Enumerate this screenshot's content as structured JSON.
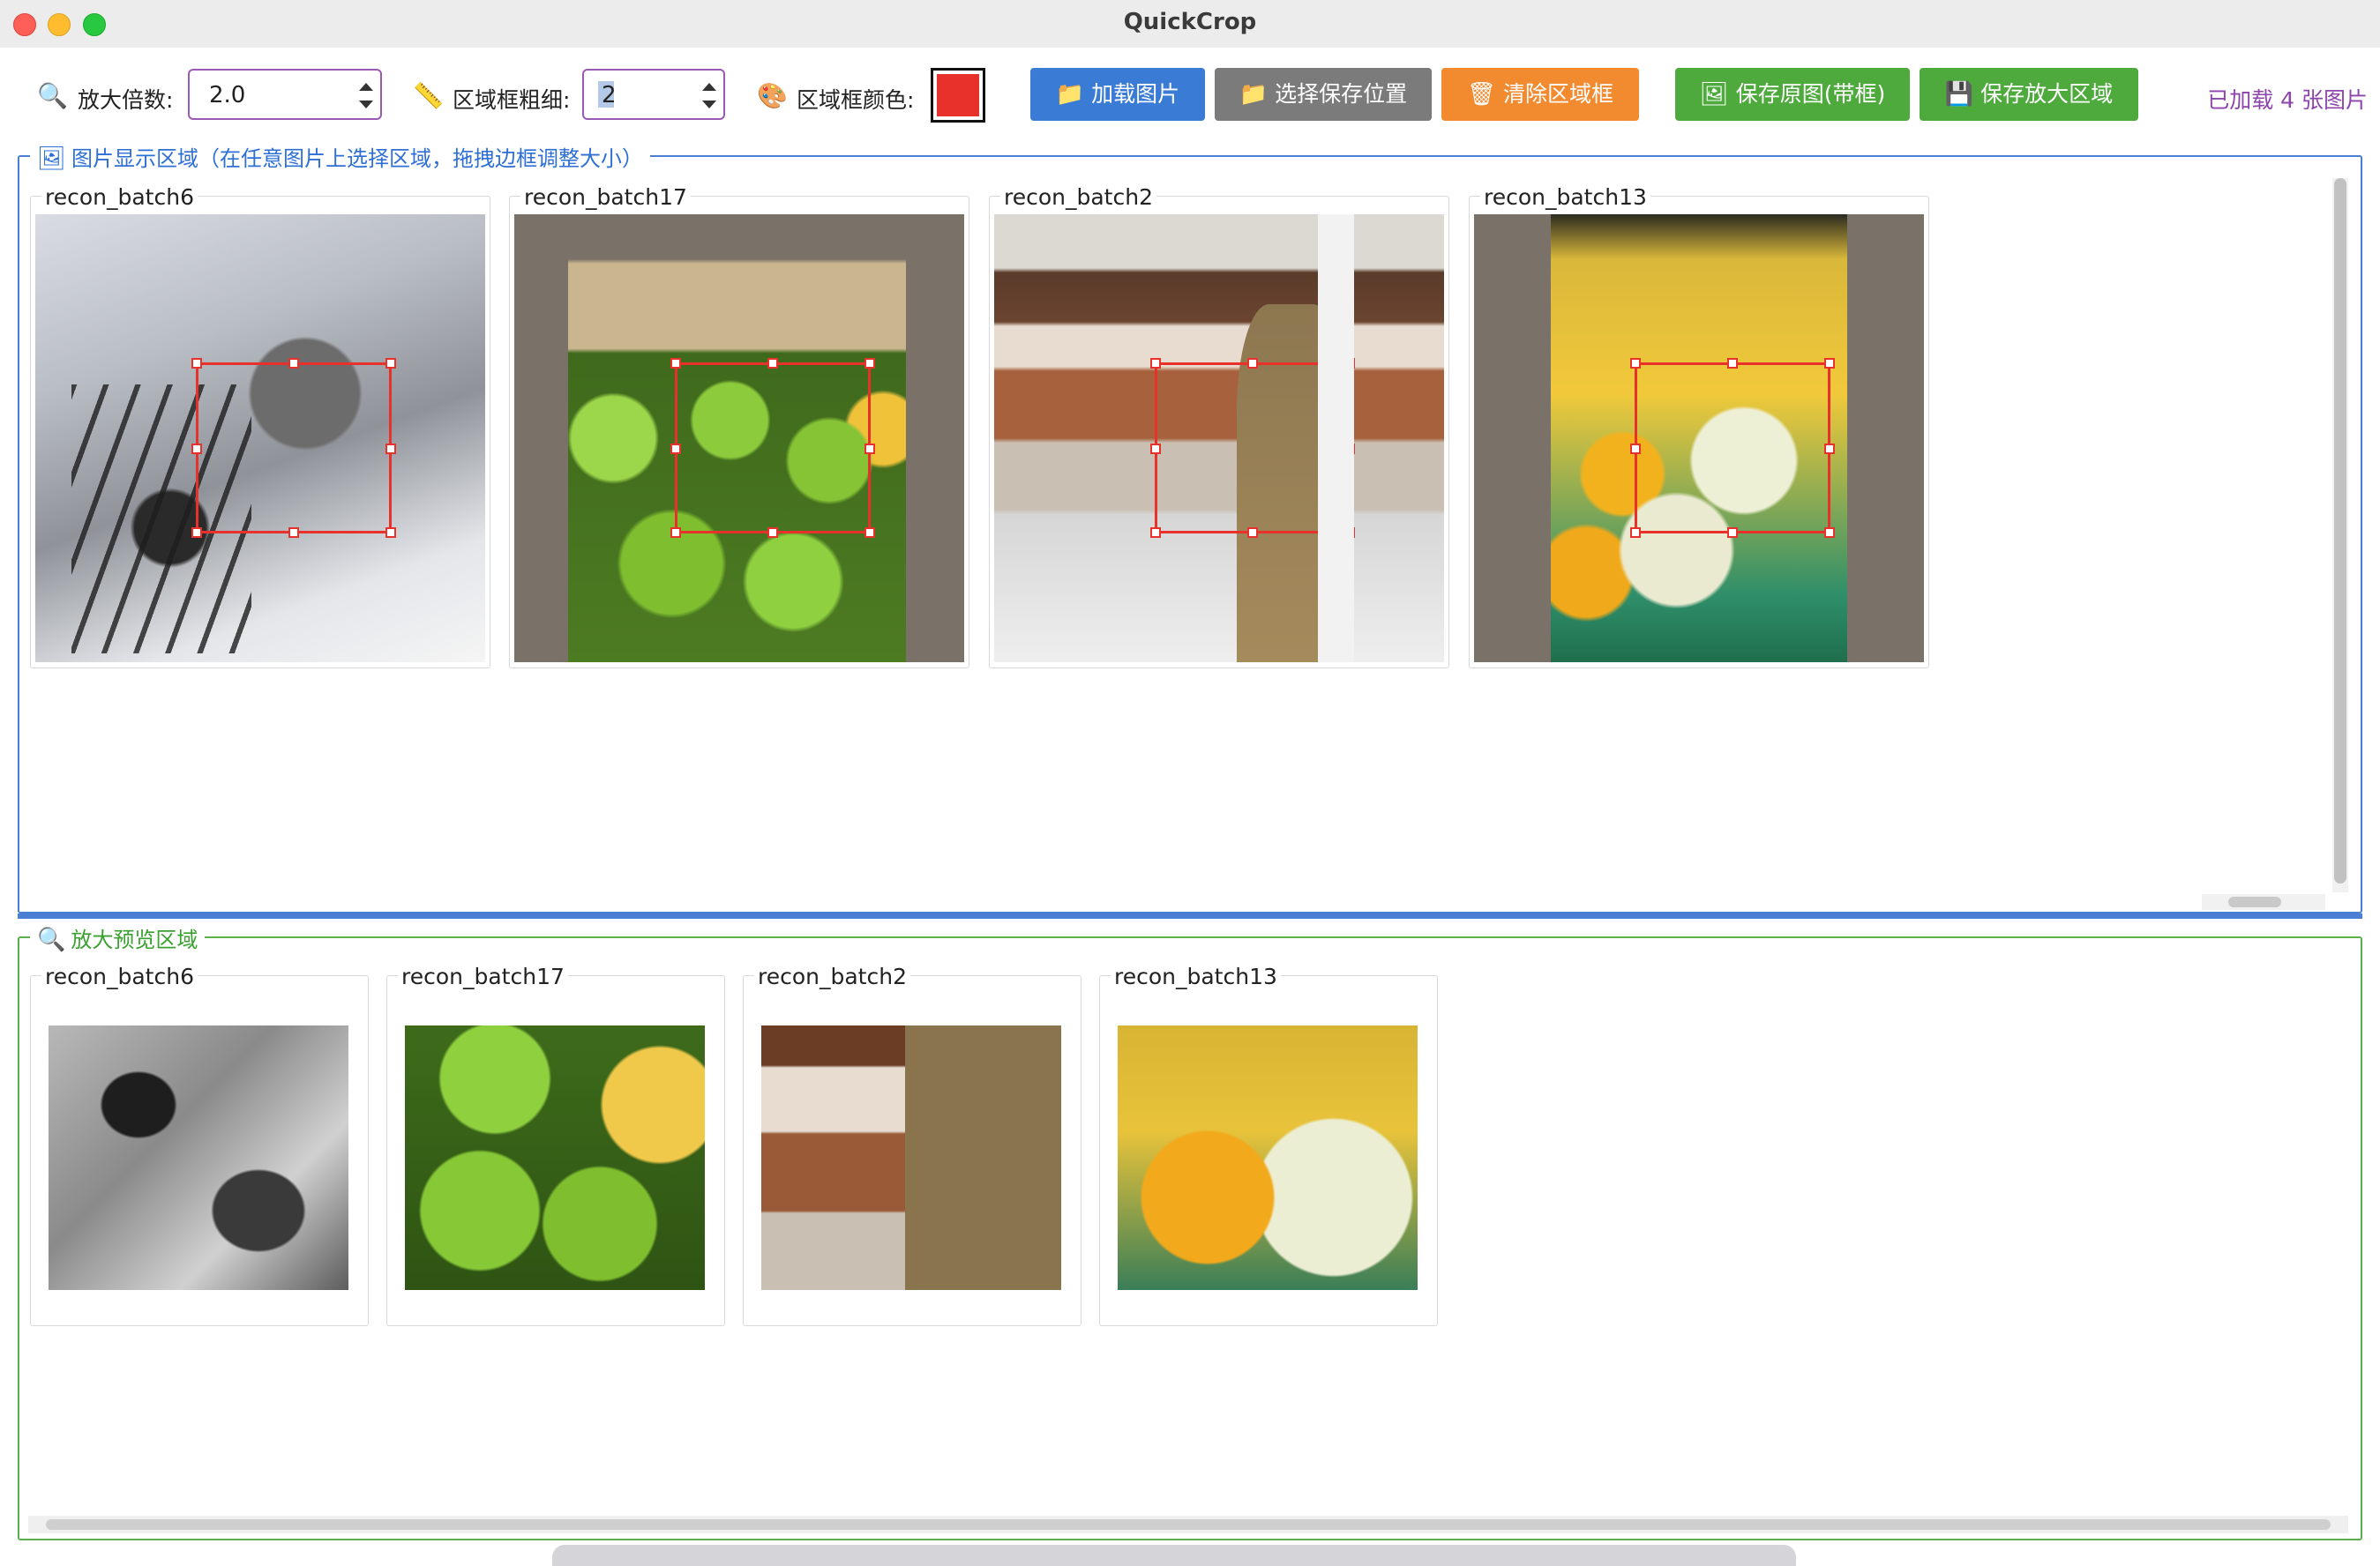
{
  "window": {
    "title": "QuickCrop"
  },
  "toolbar": {
    "zoom_label": "放大倍数:",
    "zoom_value": "2.0",
    "thickness_label": "区域框粗细:",
    "thickness_value": "2",
    "color_label": "区域框颜色:",
    "color_value": "#e8312a",
    "load_button": "加载图片",
    "choose_save_button": "选择保存位置",
    "clear_button": "清除区域框",
    "save_original_button": "保存原图(带框)",
    "save_zoom_button": "保存放大区域",
    "status": "已加载 4 张图片"
  },
  "display_area": {
    "title": "图片显示区域（在任意图片上选择区域，拖拽边框调整大小）",
    "images": [
      {
        "name": "recon_batch6"
      },
      {
        "name": "recon_batch17"
      },
      {
        "name": "recon_batch2"
      },
      {
        "name": "recon_batch13"
      }
    ]
  },
  "preview_area": {
    "title": "放大预览区域",
    "images": [
      {
        "name": "recon_batch6"
      },
      {
        "name": "recon_batch17"
      },
      {
        "name": "recon_batch2"
      },
      {
        "name": "recon_batch13"
      }
    ]
  },
  "colors": {
    "primary_blue": "#3a7bd5",
    "gray": "#7b7b7b",
    "orange": "#f28a30",
    "green": "#4eaa3c",
    "selection": "#e8312a"
  },
  "icons": {
    "zoom": "magnifier-icon",
    "thickness": "ruler-icon",
    "color": "palette-icon",
    "load": "folder-icon",
    "save_location": "folder-icon",
    "clear": "trash-icon",
    "save_original": "image-icon",
    "save_zoom": "floppy-disk-icon"
  }
}
